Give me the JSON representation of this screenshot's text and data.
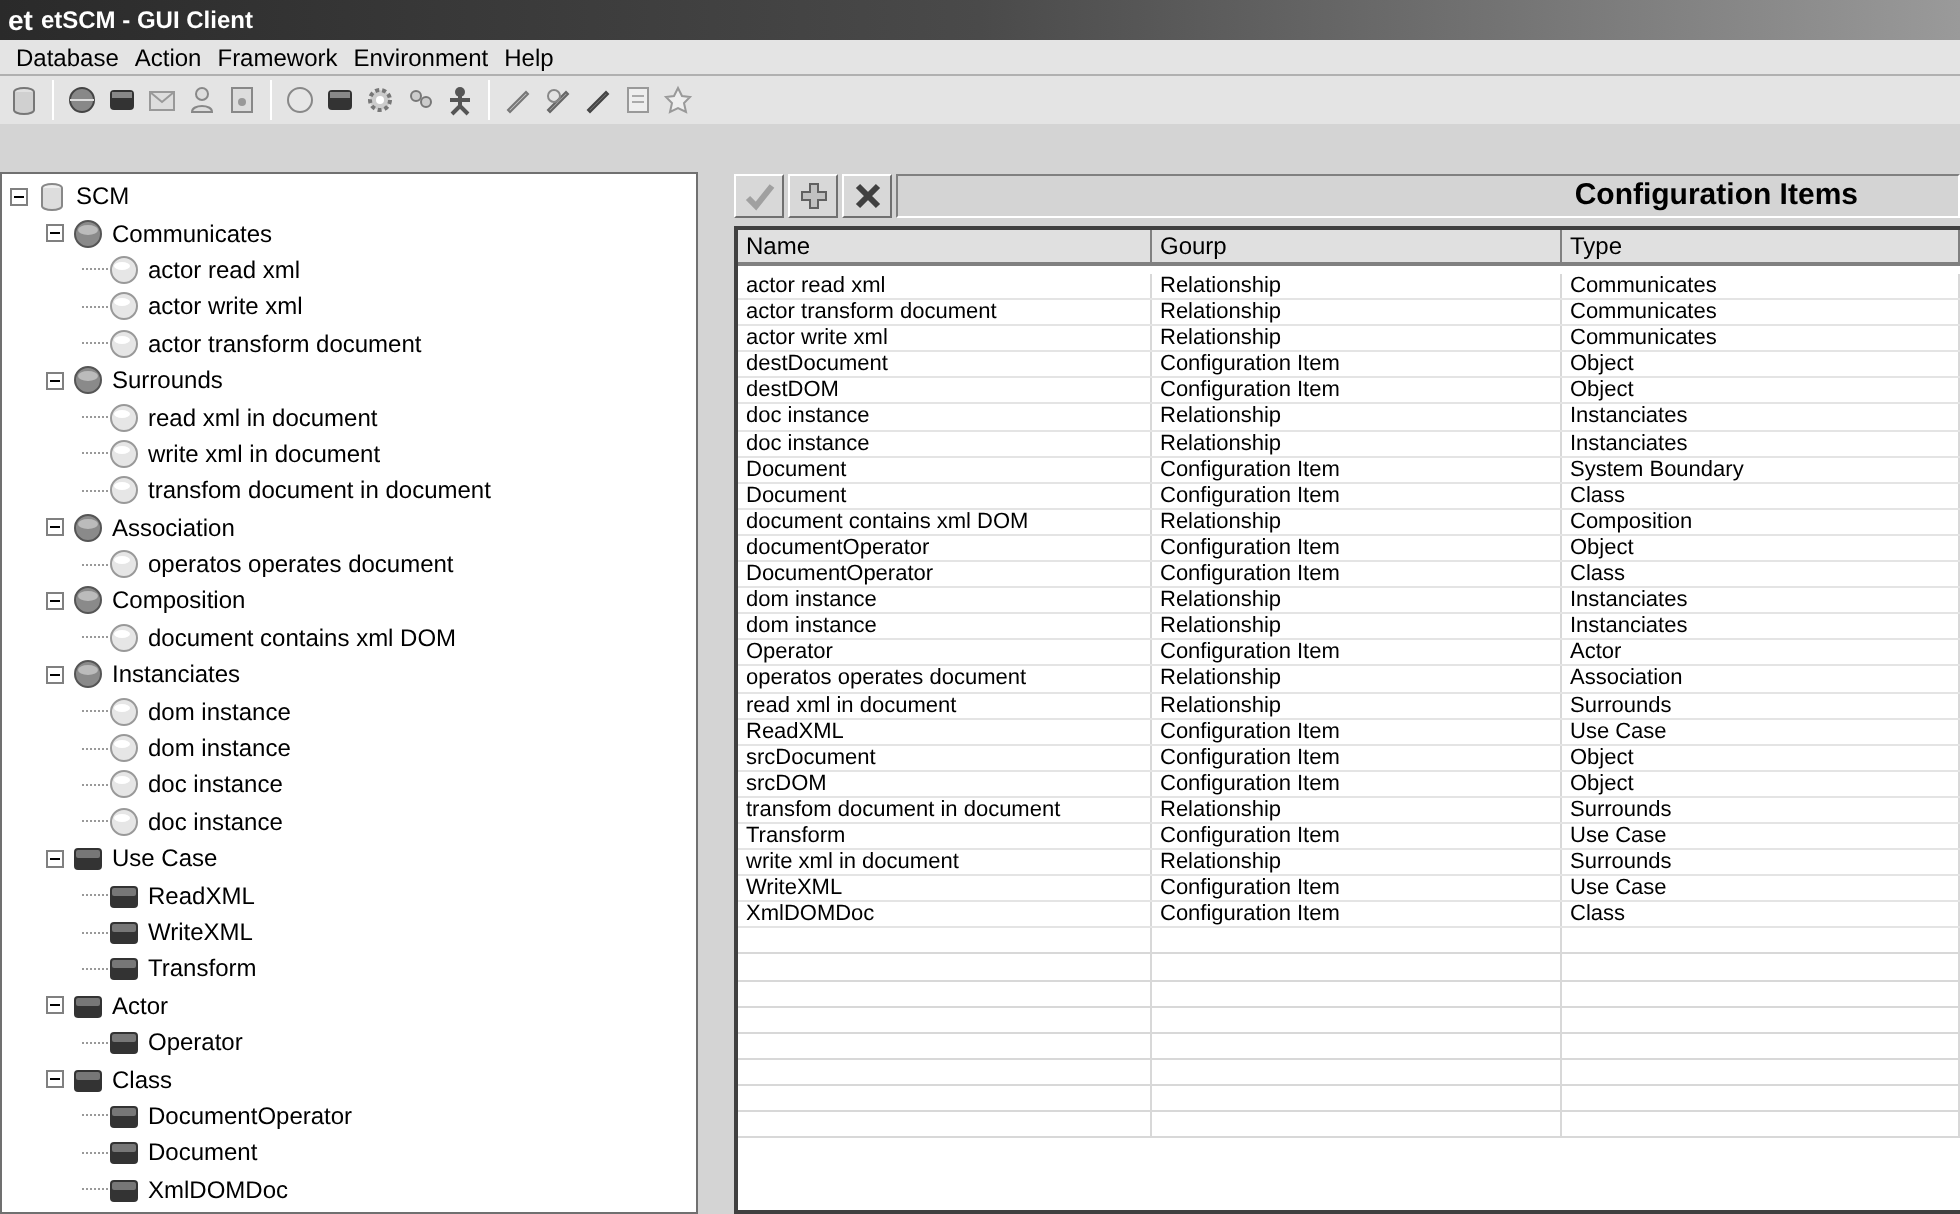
{
  "window": {
    "logo": "et",
    "title": "etSCM - GUI Client"
  },
  "menu": [
    "Database",
    "Action",
    "Framework",
    "Environment",
    "Help"
  ],
  "tree": {
    "label": "SCM",
    "kind": "database",
    "expanded": true,
    "children": [
      {
        "label": "Communicates",
        "kind": "relation",
        "expanded": true,
        "children": [
          {
            "label": "actor read xml",
            "kind": "link"
          },
          {
            "label": "actor write xml",
            "kind": "link"
          },
          {
            "label": "actor transform document",
            "kind": "link"
          }
        ]
      },
      {
        "label": "Surrounds",
        "kind": "relation",
        "expanded": true,
        "children": [
          {
            "label": "read xml in document",
            "kind": "link"
          },
          {
            "label": "write xml in document",
            "kind": "link"
          },
          {
            "label": "transfom document in document",
            "kind": "link"
          }
        ]
      },
      {
        "label": "Association",
        "kind": "relation",
        "expanded": true,
        "children": [
          {
            "label": "operatos operates document",
            "kind": "link"
          }
        ]
      },
      {
        "label": "Composition",
        "kind": "relation",
        "expanded": true,
        "children": [
          {
            "label": "document contains xml DOM",
            "kind": "link"
          }
        ]
      },
      {
        "label": "Instanciates",
        "kind": "relation",
        "expanded": true,
        "children": [
          {
            "label": "dom instance",
            "kind": "link"
          },
          {
            "label": "dom instance",
            "kind": "link"
          },
          {
            "label": "doc instance",
            "kind": "link"
          },
          {
            "label": "doc instance",
            "kind": "link"
          }
        ]
      },
      {
        "label": "Use Case",
        "kind": "item",
        "expanded": true,
        "children": [
          {
            "label": "ReadXML",
            "kind": "item"
          },
          {
            "label": "WriteXML",
            "kind": "item"
          },
          {
            "label": "Transform",
            "kind": "item"
          }
        ]
      },
      {
        "label": "Actor",
        "kind": "item",
        "expanded": true,
        "children": [
          {
            "label": "Operator",
            "kind": "item"
          }
        ]
      },
      {
        "label": "Class",
        "kind": "item",
        "expanded": true,
        "children": [
          {
            "label": "DocumentOperator",
            "kind": "item"
          },
          {
            "label": "Document",
            "kind": "item"
          },
          {
            "label": "XmlDOMDoc",
            "kind": "item"
          }
        ]
      }
    ]
  },
  "panel": {
    "title": "Configuration Items",
    "columns": [
      "Name",
      "Gourp",
      "Type"
    ],
    "rows": [
      [
        "actor read xml",
        "Relationship",
        "Communicates"
      ],
      [
        "actor transform document",
        "Relationship",
        "Communicates"
      ],
      [
        "actor write xml",
        "Relationship",
        "Communicates"
      ],
      [
        "destDocument",
        "Configuration Item",
        "Object"
      ],
      [
        "destDOM",
        "Configuration Item",
        "Object"
      ],
      [
        "doc instance",
        "Relationship",
        "Instanciates"
      ],
      [
        "doc instance",
        "Relationship",
        "Instanciates"
      ],
      [
        "Document",
        "Configuration Item",
        "System Boundary"
      ],
      [
        "Document",
        "Configuration Item",
        "Class"
      ],
      [
        "document contains xml DOM",
        "Relationship",
        "Composition"
      ],
      [
        "documentOperator",
        "Configuration Item",
        "Object"
      ],
      [
        "DocumentOperator",
        "Configuration Item",
        "Class"
      ],
      [
        "dom instance",
        "Relationship",
        "Instanciates"
      ],
      [
        "dom instance",
        "Relationship",
        "Instanciates"
      ],
      [
        "Operator",
        "Configuration Item",
        "Actor"
      ],
      [
        "operatos operates document",
        "Relationship",
        "Association"
      ],
      [
        "read xml in document",
        "Relationship",
        "Surrounds"
      ],
      [
        "ReadXML",
        "Configuration Item",
        "Use Case"
      ],
      [
        "srcDocument",
        "Configuration Item",
        "Object"
      ],
      [
        "srcDOM",
        "Configuration Item",
        "Object"
      ],
      [
        "transfom document in document",
        "Relationship",
        "Surrounds"
      ],
      [
        "Transform",
        "Configuration Item",
        "Use Case"
      ],
      [
        "write xml in document",
        "Relationship",
        "Surrounds"
      ],
      [
        "WriteXML",
        "Configuration Item",
        "Use Case"
      ],
      [
        "XmlDOMDoc",
        "Configuration Item",
        "Class"
      ]
    ]
  }
}
